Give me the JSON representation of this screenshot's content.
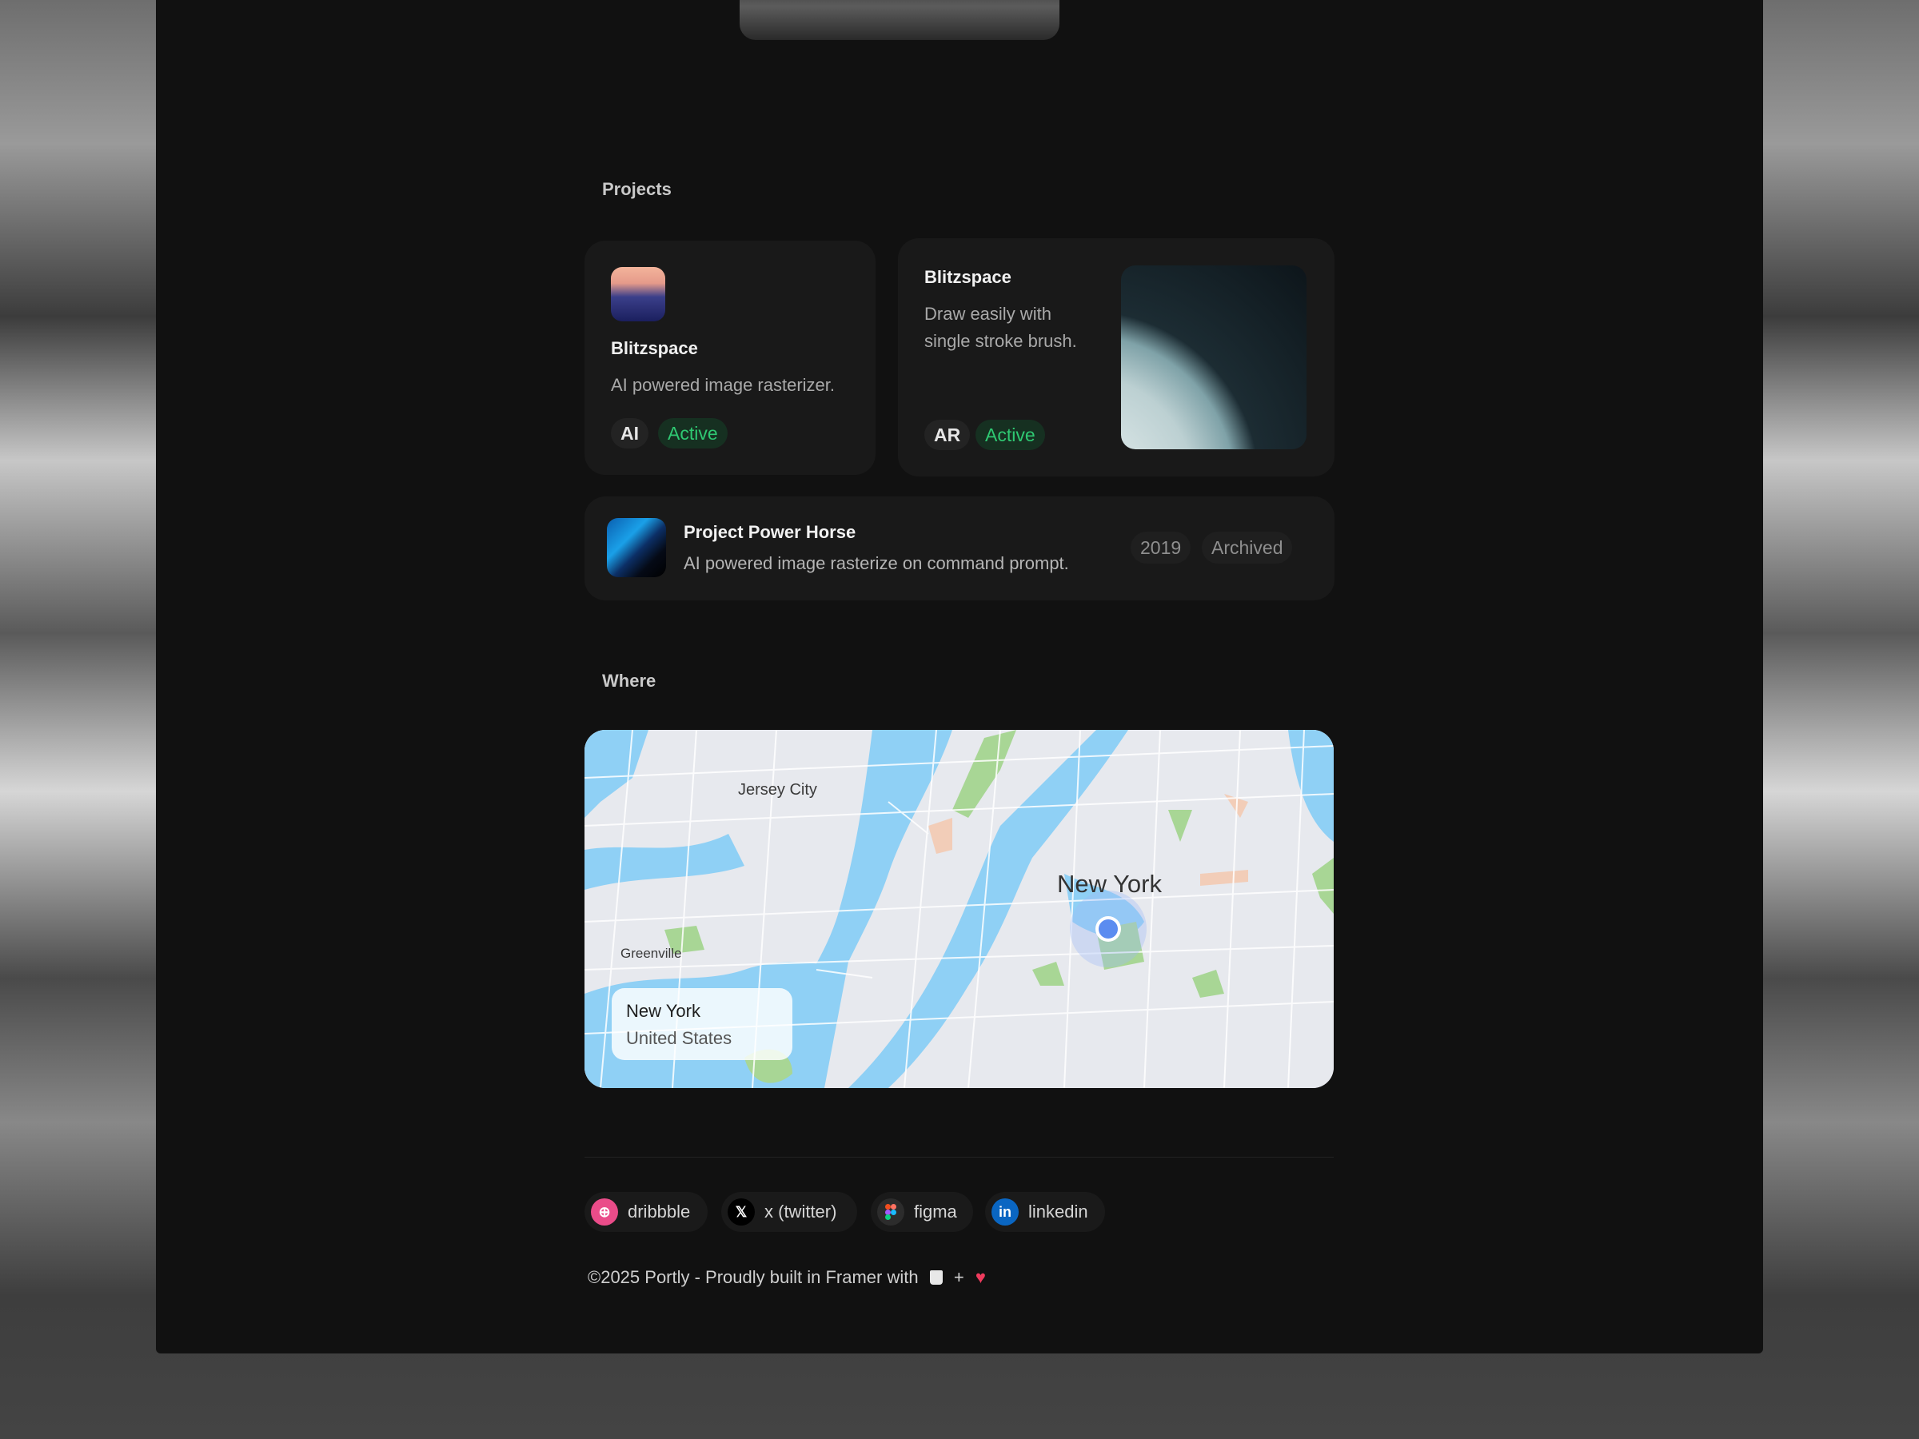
{
  "sections": {
    "projects_label": "Projects",
    "where_label": "Where"
  },
  "projects": [
    {
      "title": "Blitzspace",
      "description": "AI powered image rasterizer.",
      "tag": "AI",
      "status": "Active"
    },
    {
      "title": "Blitzspace",
      "description_line1": "Draw easily with",
      "description_line2": "single stroke brush.",
      "tag": "AR",
      "status": "Active"
    },
    {
      "title": "Project Power Horse",
      "description": "AI powered image rasterize on command prompt.",
      "year": "2019",
      "status": "Archived"
    }
  ],
  "map": {
    "labels": {
      "jersey_city": "Jersey City",
      "new_york": "New York",
      "greenville": "Greenville"
    },
    "location_card": {
      "city": "New York",
      "country": "United States"
    }
  },
  "socials": [
    {
      "label": "dribbble",
      "icon": "dribbble-icon",
      "color": "#ea4c89"
    },
    {
      "label": "x (twitter)",
      "icon": "x-icon",
      "color": "#000000"
    },
    {
      "label": "figma",
      "icon": "figma-icon",
      "color": "#f24e1e"
    },
    {
      "label": "linkedin",
      "icon": "linkedin-icon",
      "color": "#0a66c2"
    }
  ],
  "footer": {
    "text": "©2025 Portly - Proudly built in Framer with",
    "plus": "+"
  },
  "colors": {
    "panel": "#111111",
    "card": "#191919",
    "active": "#2fc872",
    "map_water": "#8fd0f5",
    "map_park": "#a8d695",
    "map_pin": "#5b8cf0"
  }
}
